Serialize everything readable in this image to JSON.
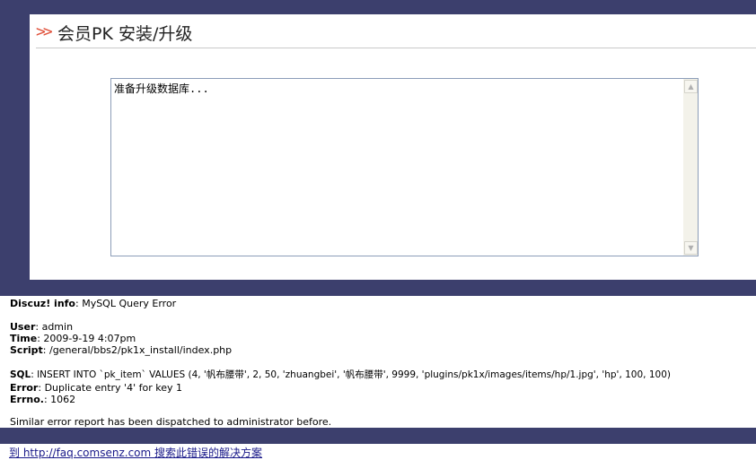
{
  "header": {
    "arrows": ">>",
    "title": "会员PK 安装/升级"
  },
  "log": {
    "text": "准备升级数据库..."
  },
  "error_report": {
    "info_label": "Discuz! info",
    "info_value": "MySQL Query Error",
    "user_label": "User",
    "user_value": "admin",
    "time_label": "Time",
    "time_value": "2009-9-19 4:07pm",
    "script_label": "Script",
    "script_value": "/general/bbs2/pk1x_install/index.php",
    "sql_label": "SQL",
    "sql_value": "INSERT INTO `pk_item` VALUES (4, '帆布腰带', 2, 50, 'zhuangbei', '帆布腰带', 9999, 'plugins/pk1x/images/items/hp/1.jpg', 'hp', 100, 100)",
    "error_label": "Error",
    "error_value": "Duplicate entry '4' for key 1",
    "errno_label": "Errno.",
    "errno_value": "1062",
    "note": "Similar error report has been dispatched to administrator before."
  },
  "footer": {
    "link_text": "到 http://faq.comsenz.com 搜索此错误的解决方案"
  },
  "colors": {
    "background": "#3c3f6d",
    "arrow_accent": "#e0523c",
    "link": "#1a1a8a"
  }
}
